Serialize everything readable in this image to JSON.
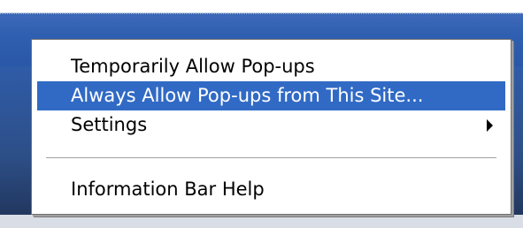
{
  "menu": {
    "items": [
      {
        "label": "Temporarily Allow Pop-ups",
        "highlighted": false,
        "has_submenu": false
      },
      {
        "label": "Always Allow Pop-ups from This Site...",
        "highlighted": true,
        "has_submenu": false
      },
      {
        "label": "Settings",
        "highlighted": false,
        "has_submenu": true
      },
      {
        "label": "Information Bar Help",
        "highlighted": false,
        "has_submenu": false
      }
    ],
    "submenu_icon": "triangle-right-icon"
  },
  "colors": {
    "highlight": "#316ac5",
    "highlight_text": "#ffffff",
    "background_bar": "#2f5fb0",
    "menu_background": "#ffffff"
  }
}
